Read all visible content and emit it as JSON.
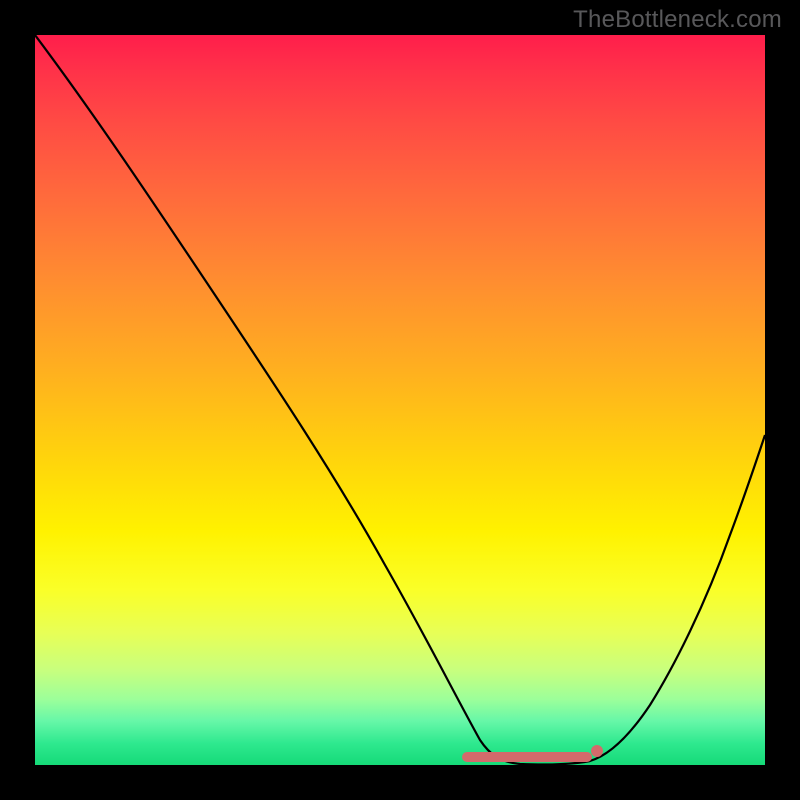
{
  "watermark": "TheBottleneck.com",
  "chart_data": {
    "type": "line",
    "title": "",
    "xlabel": "",
    "ylabel": "",
    "xlim": [
      0,
      100
    ],
    "ylim": [
      0,
      100
    ],
    "grid": false,
    "legend": false,
    "series": [
      {
        "name": "bottleneck-curve",
        "x": [
          0,
          5,
          10,
          15,
          20,
          25,
          30,
          35,
          40,
          45,
          50,
          55,
          58,
          60,
          62,
          65,
          68,
          72,
          76,
          80,
          84,
          88,
          92,
          96,
          100
        ],
        "values": [
          100,
          93,
          86,
          79,
          71,
          63,
          55,
          46,
          37,
          28,
          19,
          10,
          5,
          2,
          1,
          0,
          0,
          0,
          1,
          3,
          8,
          15,
          24,
          34,
          45
        ]
      }
    ],
    "trough_marker": {
      "x_start": 58,
      "x_end": 76,
      "y": 0
    },
    "marker_dot": {
      "x": 77,
      "y": 2
    },
    "colors": {
      "curve": "#000000",
      "marker": "#d36a6b",
      "gradient_top": "#ff1e4b",
      "gradient_mid": "#fff200",
      "gradient_bottom": "#15da78",
      "background": "#000000",
      "watermark": "#58585a"
    }
  }
}
